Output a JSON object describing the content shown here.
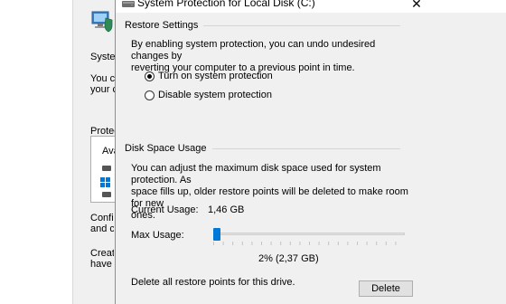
{
  "dialog": {
    "title": "System Protection for Local Disk (C:)",
    "close_glyph": "✕"
  },
  "restore_settings": {
    "header": "Restore Settings",
    "description_line1": "By enabling system protection, you can undo undesired changes by",
    "description_line2": "reverting your computer to a previous point in time.",
    "options": [
      {
        "label": "Turn on system protection",
        "checked": true
      },
      {
        "label": "Disable system protection",
        "checked": false
      }
    ]
  },
  "disk_space": {
    "header": "Disk Space Usage",
    "description_line1": "You can adjust the maximum disk space used for system protection. As",
    "description_line2": "space fills up, older restore points will be deleted to make room for new",
    "description_line3": "ones.",
    "current_usage_label": "Current Usage:",
    "current_usage_value": "1,46 GB",
    "max_usage_label": "Max Usage:",
    "max_usage_percent": 2,
    "max_usage_text": "2% (2,37 GB)",
    "delete_text": "Delete all restore points for this drive.",
    "delete_button": "Delete"
  },
  "background_window": {
    "text_system": "System",
    "text_you_ca": "You ca",
    "text_your_c": "your c",
    "text_protection": "Protectio",
    "text_ava": "Ava",
    "text_config": "Confi",
    "text_and": "and c",
    "text_create": "Creat",
    "text_have": "have"
  },
  "colors": {
    "accent": "#0078d7",
    "dialog_bg": "#f0f0f0",
    "rule": "#d5d5d5"
  }
}
